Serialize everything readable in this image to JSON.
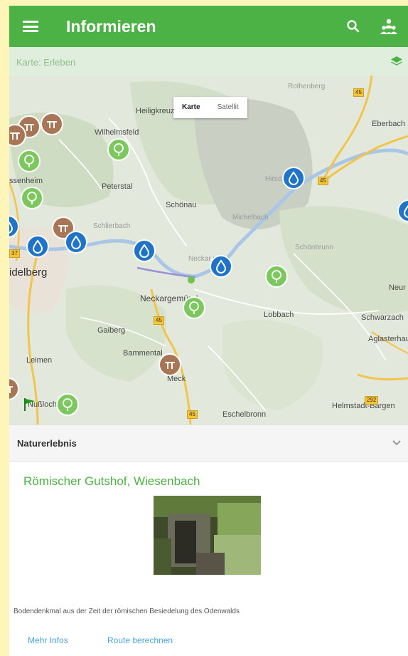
{
  "topbar": {
    "title": "Informieren",
    "color": "#4db245",
    "icons": [
      "menu-icon",
      "search-icon",
      "people-icon"
    ]
  },
  "map_header": {
    "label": "Karte: Erleben",
    "icon": "layers-icon"
  },
  "map": {
    "type_toggle": [
      "Karte",
      "Satellit"
    ],
    "places": {
      "heiligkreuz": "Heiligkreuz",
      "rothenberg": "Rothenberg",
      "eberbach": "Eberbach",
      "wilhelmsfeld": "Wilhelmsfeld",
      "ssenheim": "ssenheim",
      "peterstal": "Peterstal",
      "schoenau": "Schönau",
      "hirschhorn": "Hirsch (Ne",
      "michelbach": "Michelbach",
      "schlierbach": "Schlierbach",
      "schoenbrunn": "Schönbrunn",
      "neckarsteinach": "Neckar     nach",
      "delberg": "idelberg",
      "neckargemuend": "Neckargemünd",
      "neur": "Neur",
      "lobbach": "Lobbach",
      "schwarzach": "Schwarzach",
      "gaiberg": "Gaiberg",
      "aglasterhausen": "Aglasterhau",
      "bammental": "Bammental",
      "leimen": "Leimen",
      "meckesheim": "Meck",
      "nussloch": "Nußloch",
      "eschelbronn": "Eschelbronn",
      "helmstadt": "Helmstadt-Bargen"
    },
    "road_badges": [
      "45",
      "45",
      "37",
      "45",
      "45",
      "292"
    ]
  },
  "section": {
    "title": "Naturerlebnis",
    "expand_icon": "chevron-down-icon"
  },
  "detail": {
    "title": "Römischer Gutshof, Wiesenbach",
    "description": "Bodendenkmal aus der Zeit der römischen Besiedelung des Odenwalds",
    "more_link": "Mehr Infos",
    "route_link": "Route berechnen"
  }
}
